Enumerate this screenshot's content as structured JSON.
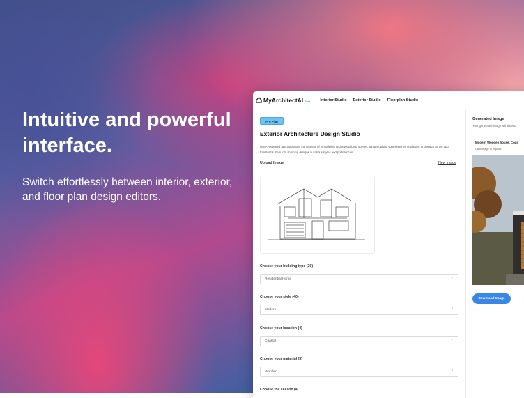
{
  "hero": {
    "headline": "Intuitive and powerful interface.",
    "subline": "Switch effortlessly between interior, exterior, and floor plan design editors."
  },
  "app": {
    "logo_text": "MyArchitectAI",
    "beta_label": "Beta",
    "nav": [
      "Interior Studio",
      "Exterior Studio",
      "Floorplan Studio"
    ],
    "plan_badge": "Pro Plan",
    "title": "Exterior Architecture Design Studio",
    "description": "Our AI-powered app automates the process of remodeling and revisualizing scenes. Simply upload your sketches or photos, and watch as the app transforms them into stunning designs in various styles and preferences.",
    "upload_label": "Upload Image",
    "new_image_link": "New image",
    "fields": [
      {
        "label": "Choose your building type (20)",
        "value": "Residential Home"
      },
      {
        "label": "Choose your style (40)",
        "value": "Modern"
      },
      {
        "label": "Choose your location (4)",
        "value": "Coastal"
      },
      {
        "label": "Choose your material (5)",
        "value": "Wooden"
      },
      {
        "label": "Choose the season (4)",
        "value": ""
      }
    ],
    "generated": {
      "title": "Generated Image",
      "subtitle": "Your generated image will show u",
      "caption": "Modern Wooden house, Coas",
      "expand_hint": "Click image to expand",
      "download_label": "Download Image"
    }
  }
}
